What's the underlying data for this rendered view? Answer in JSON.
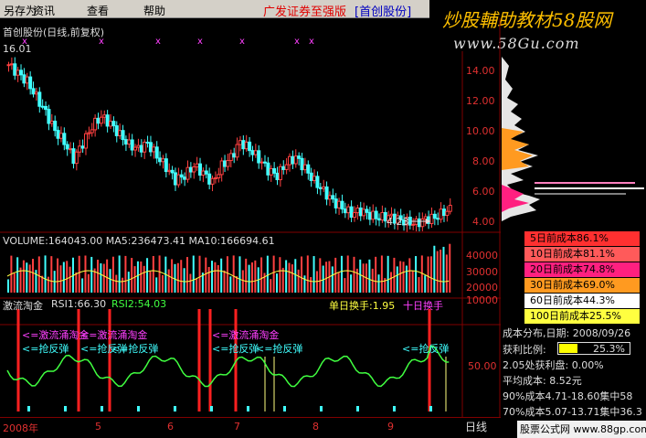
{
  "menu": {
    "items": [
      "另存为",
      "资讯",
      "查看",
      "帮助"
    ]
  },
  "window": {
    "title": "广发证券至强版",
    "subtitle": "[首创股份]"
  },
  "watermark": {
    "title": "炒股輔助教材58股网",
    "url": "www.58Gu.com"
  },
  "stock": {
    "header": "首创股份(日线,前复权)",
    "high_label": "16.01",
    "low_label": "4.23"
  },
  "price_axis": [
    "14.00",
    "12.00",
    "10.00",
    "8.00",
    "6.00",
    "4.00"
  ],
  "volume": {
    "header": "VOLUME:164043.00 MA5:236473.41 MA10:166694.61",
    "axis": [
      "40000",
      "30000",
      "20000",
      "10000"
    ]
  },
  "indicator": {
    "name": "激流淘金",
    "rsi": "RSI1:66.30",
    "rsi2": "RSI2:54.03",
    "turnover": "单日换手:1.95",
    "turnover10": "十日换手",
    "signal_buy": "<=激流涌淘金",
    "signal_rebound": "<=抢反弹",
    "axis": [
      "50.00"
    ]
  },
  "cost_table": [
    {
      "label": "5日前成本86.1%",
      "color": "#ff3030"
    },
    {
      "label": "10日前成本81.1%",
      "color": "#ff5a5a"
    },
    {
      "label": "20日前成本74.8%",
      "color": "#ff2080"
    },
    {
      "label": "30日前成本69.0%",
      "color": "#ff9a20"
    },
    {
      "label": "60日前成本44.3%",
      "color": "#ffffff"
    },
    {
      "label": "100日前成本25.5%",
      "color": "#ffff40"
    }
  ],
  "info": {
    "dist_date": "成本分布,日期: 2008/09/26",
    "profit_ratio_label": "获利比例:",
    "profit_ratio": "25.3%",
    "profit_ratio_value": 0.253,
    "profit_line": "2.05处获利盘: 0.00%",
    "avg_cost": "平均成本: 8.52元",
    "c90": "90%成本4.71-18.60集中58",
    "c70": "70%成本5.07-13.71集中36.3"
  },
  "dates": [
    "2008年",
    "5",
    "6",
    "7",
    "8",
    "9"
  ],
  "bottom": {
    "period": "日线",
    "footer": "股票公式网 www.88gp.com"
  },
  "chart_data": {
    "type": "candlestick",
    "high": 16.01,
    "low": 4.23,
    "price_range": [
      4.0,
      16.5
    ],
    "trend": [
      15.8,
      15.2,
      14.6,
      13.5,
      12.4,
      11.1,
      10.3,
      9.1,
      10.2,
      11.4,
      12.1,
      11.6,
      10.8,
      10.1,
      9.8,
      10.2,
      9.3,
      8.5,
      7.6,
      7.9,
      8.6,
      8.1,
      7.4,
      8.6,
      9.2,
      10.3,
      9.8,
      9.1,
      8.3,
      7.9,
      8.8,
      9.2,
      8.4,
      7.5,
      6.8,
      6.1,
      5.6,
      5.2,
      5.4,
      5.1,
      4.9,
      5.0,
      4.8,
      4.6,
      4.5,
      4.8,
      4.9,
      5.3,
      5.6
    ]
  }
}
